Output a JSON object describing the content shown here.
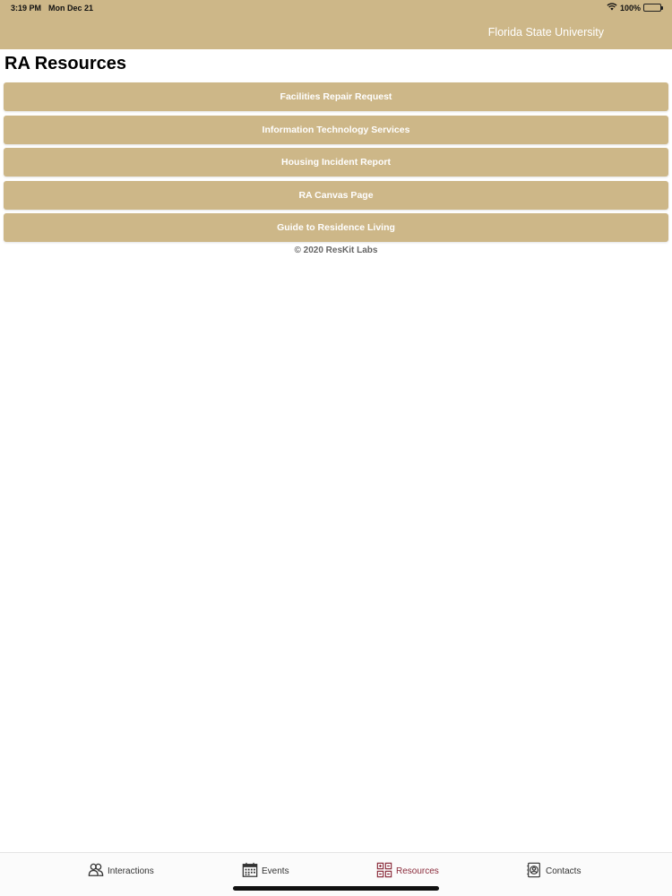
{
  "status_bar": {
    "time": "3:19 PM",
    "date": "Mon Dec 21",
    "battery": "100%"
  },
  "header": {
    "title": "Florida State University"
  },
  "page": {
    "title": "RA Resources",
    "buttons": [
      {
        "label": "Facilities Repair Request"
      },
      {
        "label": "Information Technology Services"
      },
      {
        "label": "Housing Incident Report"
      },
      {
        "label": "RA Canvas Page"
      },
      {
        "label": "Guide to Residence Living"
      }
    ],
    "copyright": "© 2020 ResKit Labs"
  },
  "tabbar": {
    "tabs": [
      {
        "label": "Interactions",
        "icon": "people-icon"
      },
      {
        "label": "Events",
        "icon": "calendar-icon"
      },
      {
        "label": "Resources",
        "icon": "resources-icon",
        "active": true
      },
      {
        "label": "Contacts",
        "icon": "contacts-icon"
      }
    ]
  },
  "colors": {
    "accent": "#cdb788",
    "active_tab": "#8a2a3a"
  }
}
